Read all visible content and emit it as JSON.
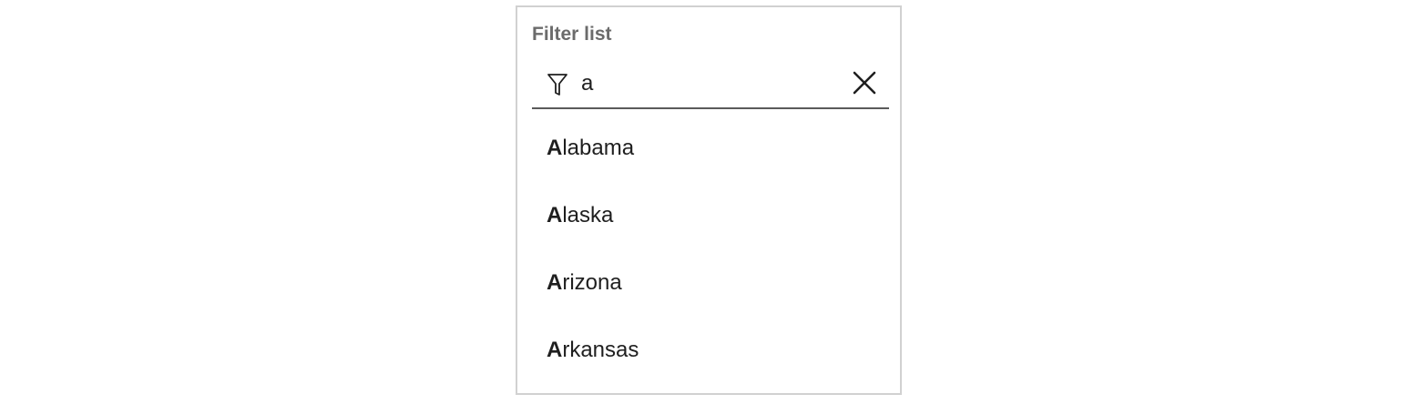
{
  "filter": {
    "label": "Filter list",
    "value": "a",
    "placeholder": ""
  },
  "icons": {
    "filter": "funnel-icon",
    "clear": "close-icon"
  },
  "results": [
    {
      "match": "A",
      "rest": "labama"
    },
    {
      "match": "A",
      "rest": "laska"
    },
    {
      "match": "A",
      "rest": "rizona"
    },
    {
      "match": "A",
      "rest": "rkansas"
    }
  ],
  "colors": {
    "panel_border": "#d1d1d1",
    "label": "#6b6b6b",
    "underline": "#5a5a5a",
    "text": "#1f1f1f"
  }
}
